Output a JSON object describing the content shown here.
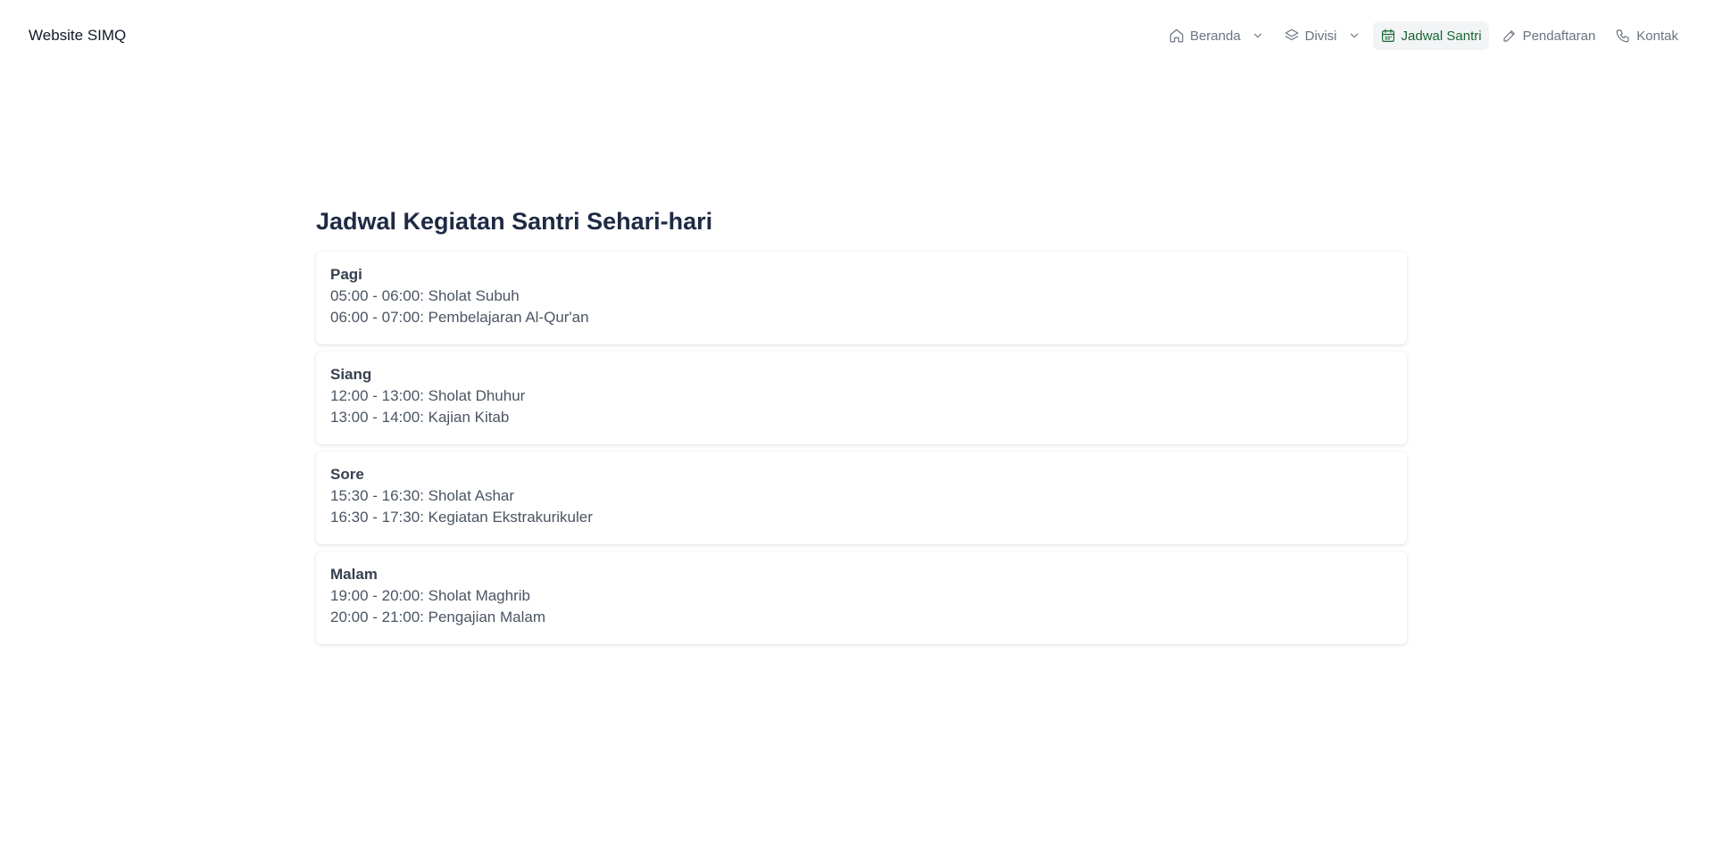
{
  "brand": {
    "title": "Website SIMQ"
  },
  "nav": {
    "items": [
      {
        "label": "Beranda",
        "icon": "home-icon",
        "has_dropdown": true,
        "active": false
      },
      {
        "label": "Divisi",
        "icon": "layers-icon",
        "has_dropdown": true,
        "active": false
      },
      {
        "label": "Jadwal Santri",
        "icon": "calendar-icon",
        "has_dropdown": false,
        "active": true
      },
      {
        "label": "Pendaftaran",
        "icon": "pencil-icon",
        "has_dropdown": false,
        "active": false
      },
      {
        "label": "Kontak",
        "icon": "phone-icon",
        "has_dropdown": false,
        "active": false
      }
    ]
  },
  "main": {
    "title": "Jadwal Kegiatan Santri Sehari-hari",
    "sections": [
      {
        "title": "Pagi",
        "items": [
          "05:00 - 06:00: Sholat Subuh",
          "06:00 - 07:00: Pembelajaran Al-Qur'an"
        ]
      },
      {
        "title": "Siang",
        "items": [
          "12:00 - 13:00: Sholat Dhuhur",
          "13:00 - 14:00: Kajian Kitab"
        ]
      },
      {
        "title": "Sore",
        "items": [
          "15:30 - 16:30: Sholat Ashar",
          "16:30 - 17:30: Kegiatan Ekstrakurikuler"
        ]
      },
      {
        "title": "Malam",
        "items": [
          "19:00 - 20:00: Sholat Maghrib",
          "20:00 - 21:00: Pengajian Malam"
        ]
      }
    ]
  },
  "colors": {
    "active_nav_text": "#166534",
    "active_nav_bg": "#f3f4f6",
    "nav_text": "#6b7280",
    "title_text": "#1f2a44"
  }
}
